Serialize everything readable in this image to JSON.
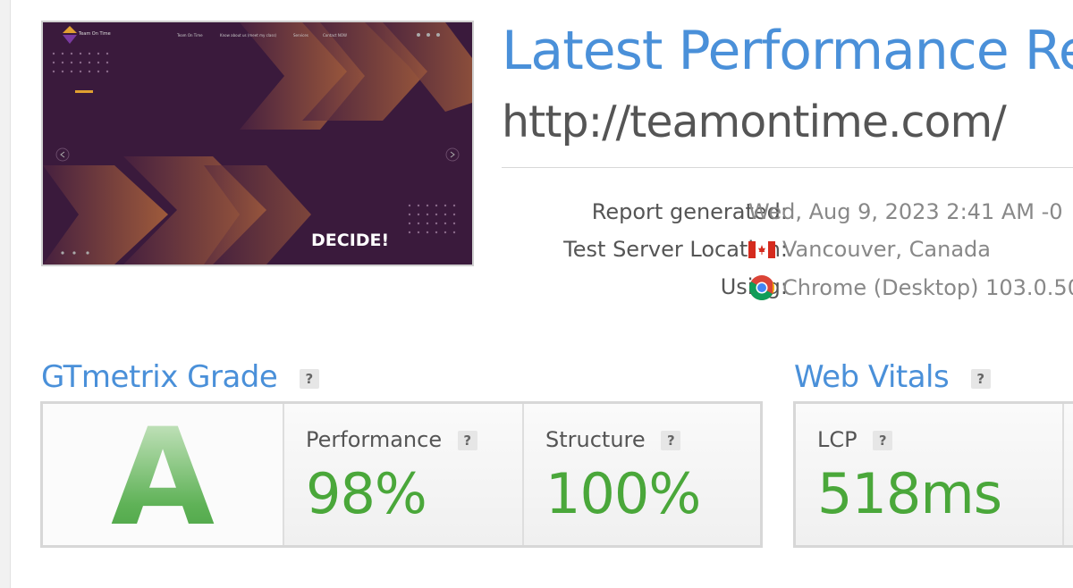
{
  "thumbnail": {
    "logo_text": "Team On Time",
    "nav": [
      "Team On Time",
      "Know about us (meet my class)",
      "Services",
      "Contact NOW"
    ],
    "hero_text": "DECIDE!"
  },
  "header": {
    "title": "Latest Performance Re",
    "url": "http://teamontime.com/"
  },
  "meta": {
    "report_label": "Report generated:",
    "report_value": "Wed, Aug 9, 2023 2:41 AM -0",
    "location_label": "Test Server Location:",
    "location_value": "Vancouver, Canada",
    "using_label": "Using:",
    "using_value": "Chrome (Desktop) 103.0.50"
  },
  "grade": {
    "title": "GTmetrix Grade",
    "help": "?",
    "letter": "A",
    "performance_label": "Performance",
    "performance_value": "98%",
    "structure_label": "Structure",
    "structure_value": "100%"
  },
  "vitals": {
    "title": "Web Vitals",
    "help": "?",
    "lcp_label": "LCP",
    "lcp_value": "518ms"
  },
  "colors": {
    "accent_blue": "#4a90d9",
    "grade_green": "#4aa73a",
    "thumb_bg": "#3a1a3c"
  }
}
